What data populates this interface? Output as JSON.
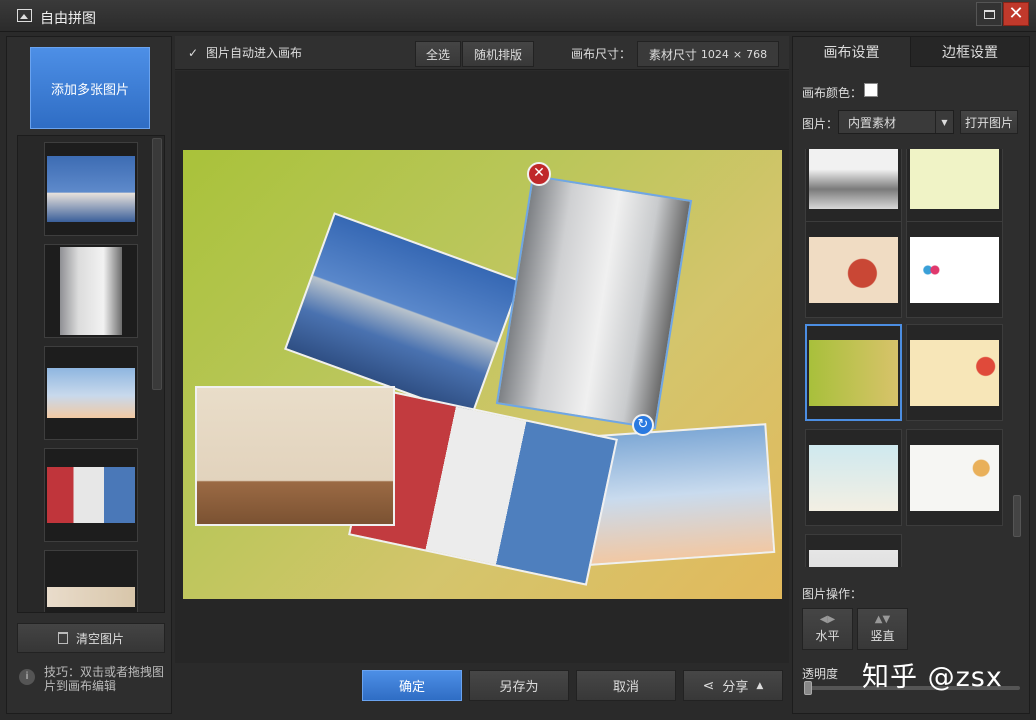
{
  "window": {
    "title": "自由拼图"
  },
  "left": {
    "add_button": "添加多张图片",
    "clear_button": "清空图片",
    "tip": "技巧：双击或者拖拽图片到画布编辑"
  },
  "toolbar": {
    "auto_enter_label": "图片自动进入画布",
    "select_all": "全选",
    "random_arrange": "随机排版",
    "canvas_size_label": "画布尺寸：",
    "canvas_size_value": "素材尺寸",
    "canvas_width": "1024",
    "times": "×",
    "canvas_height": "768"
  },
  "bottom": {
    "confirm": "确定",
    "save_as": "另存为",
    "cancel": "取消",
    "share": "分享"
  },
  "right": {
    "tabs": [
      "画布设置",
      "边框设置"
    ],
    "canvas_color_label": "画布颜色：",
    "image_label": "图片：",
    "image_source": "内置素材",
    "open_image": "打开图片",
    "image_ops_label": "图片操作：",
    "flip_horizontal": "水平",
    "flip_vertical": "竖直",
    "opacity_label": "透明度"
  },
  "colors": {
    "accent": "#3a7bd5",
    "close_red": "#c0282a"
  },
  "watermark": "知乎 @zsx"
}
